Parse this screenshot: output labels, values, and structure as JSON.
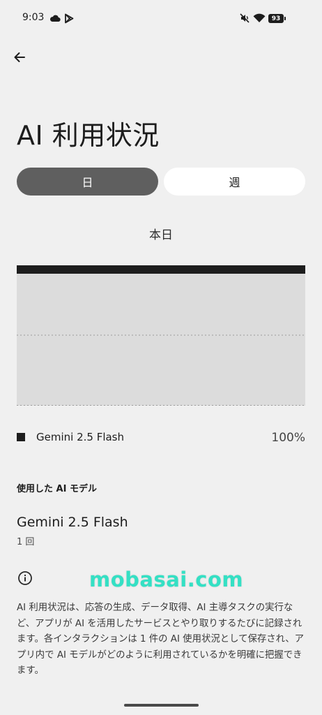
{
  "status_bar": {
    "time": "9:03",
    "battery": "93",
    "icons": [
      "cloud-icon",
      "play-store-icon",
      "mute-icon",
      "wifi-icon",
      "battery-icon"
    ]
  },
  "header": {
    "back_icon": "arrow-left-icon",
    "title": "AI 利用状況"
  },
  "tabs": [
    {
      "label": "日",
      "selected": true
    },
    {
      "label": "週",
      "selected": false
    }
  ],
  "period_label": "本日",
  "chart_data": {
    "type": "bar",
    "categories": [
      ""
    ],
    "series": [
      {
        "name": "Gemini 2.5 Flash",
        "values": [
          100
        ],
        "color": "#1d1d1d"
      }
    ],
    "legend": [
      {
        "name": "Gemini 2.5 Flash",
        "value": "100%"
      }
    ],
    "grid": true
  },
  "models_section": {
    "title": "使用した AI モデル",
    "items": [
      {
        "name": "Gemini 2.5 Flash",
        "count": "1 回"
      }
    ]
  },
  "info": {
    "icon": "info-icon",
    "text": "AI 利用状況は、応答の生成、データ取得、AI 主導タスクの実行など、アプリが AI を活用したサービスとやり取りするたびに記録されます。各インタラクションは 1 件の AI 使用状況として保存され、アプリ内で AI モデルがどのように利用されているかを明確に把握できます。"
  },
  "watermark": "mobasai.com",
  "colors": {
    "background": "#f0f0f0",
    "selected_tab": "#5f5f5f",
    "unselected_tab": "#ffffff",
    "bar": "#1d1d1d",
    "chart_bg": "#dcdcdc",
    "watermark": "#34e0c4"
  }
}
